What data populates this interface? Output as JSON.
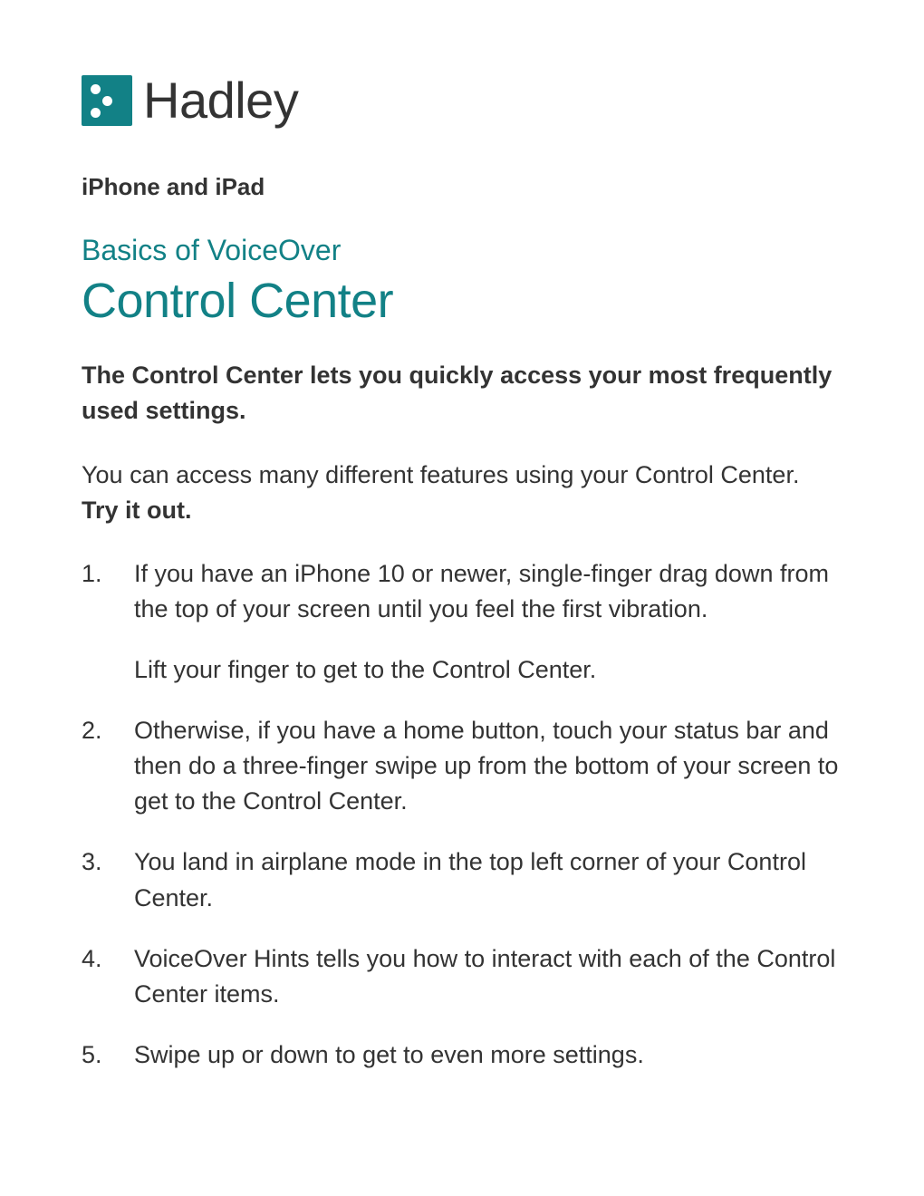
{
  "logo": {
    "text": "Hadley"
  },
  "category": "iPhone and iPad",
  "subtitle": "Basics of VoiceOver",
  "title": "Control Center",
  "intro_bold": "The Control Center lets you quickly access your most frequently used settings.",
  "intro_para_pre": "You can access many different features using your Control Center. ",
  "intro_para_bold": "Try it out.",
  "steps": [
    {
      "main": "If you have an iPhone 10 or newer, single-finger drag down from the top of your screen until you feel the first vibration.",
      "sub": "Lift your finger to get to the Control Center."
    },
    {
      "main": "Otherwise, if you have a home button, touch your status bar and then do a three-finger swipe up from the bottom of your screen to get to the Control Center."
    },
    {
      "main": "You land in airplane mode in the top left corner of your Control Center."
    },
    {
      "main": "VoiceOver Hints tells you how to interact with each of the Control Center items."
    },
    {
      "main": "Swipe up or down to get to even more settings."
    }
  ]
}
